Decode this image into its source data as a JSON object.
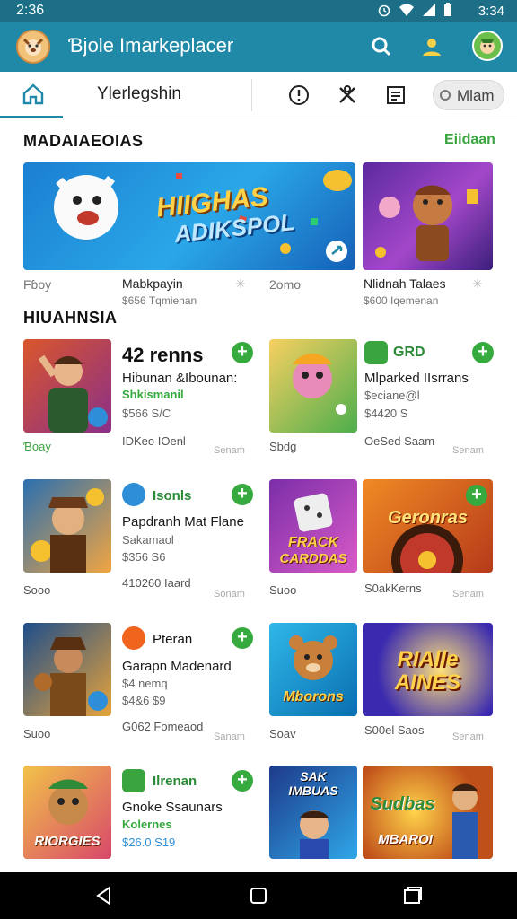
{
  "status": {
    "time_left": "2:36",
    "time_right": "3:34"
  },
  "appbar": {
    "title": "Ɓjole Imarkeplacer"
  },
  "tabs": {
    "label": "Ylerlegshin",
    "search": "Mlam"
  },
  "section1": {
    "title": "MADAIAEOIAS",
    "see_all": "Eiidaan",
    "banner_text1": "HIIGHAS",
    "banner_text2": "ADIKSPOL",
    "left_label": "Fɓoy",
    "item1_name": "Mabkpayin",
    "item1_sub": "$656 Tqmienan",
    "mid_label": "2omo",
    "item2_name": "Nlidnah Talaes",
    "item2_sub": "$600 Iqemenan"
  },
  "section2": {
    "title": "HIUAHNSIA",
    "cards": [
      {
        "tag": "42 renns",
        "name": "Hibunan &Ibounan:",
        "green": "Shkismanil",
        "stat": "$566 S/C",
        "foot": "Ɓoay",
        "foot2": "IDKeo IOenl",
        "small": "Senam"
      },
      {
        "tag": "GRD",
        "name": "Mlparked IIsrrans",
        "green": "",
        "stat1": "$eciane@l",
        "stat": "$4420 S",
        "foot": "Sbdg",
        "foot2": "OeSed Saam",
        "small": "Senam"
      },
      {
        "tag": "Isonls",
        "name": "Papdranh Mat Flane",
        "green": "",
        "stat1": "Sakamaol",
        "stat": "$356 S6",
        "foot": "Sooo",
        "foot2": "410260 Iaard",
        "small": "Sonam"
      },
      {
        "tag": "",
        "name": "",
        "green": "",
        "stat": "",
        "foot": "Suoo",
        "foot2": "S0akKerns",
        "small": "Senam",
        "banner": "Geronras"
      },
      {
        "tag": "Pteran",
        "name": "Garapn Madenard",
        "stat1": "$4 nemq",
        "stat": "$4&6 $9",
        "foot": "Suoo",
        "foot2": "G062 Fomeaod",
        "small": "Sanam"
      },
      {
        "tag": "",
        "name": "",
        "foot": "Soav",
        "foot2": "S00el Saos",
        "small": "Senam",
        "banner": "RIAlle AINES"
      },
      {
        "tag": "Ilrenan",
        "name": "Gnoke Ssaunars",
        "green": "Kolernes",
        "stat": "$26.0 S19"
      }
    ],
    "thumb_texts": {
      "t2a": "FRACK",
      "t2b": "CARDDAS",
      "t5": "Mborons",
      "t7a": "SAK",
      "t7b": "IMBUAS",
      "t8": "Sudbas",
      "t8b": "MBAROI",
      "t1": "RIORGIES"
    }
  }
}
